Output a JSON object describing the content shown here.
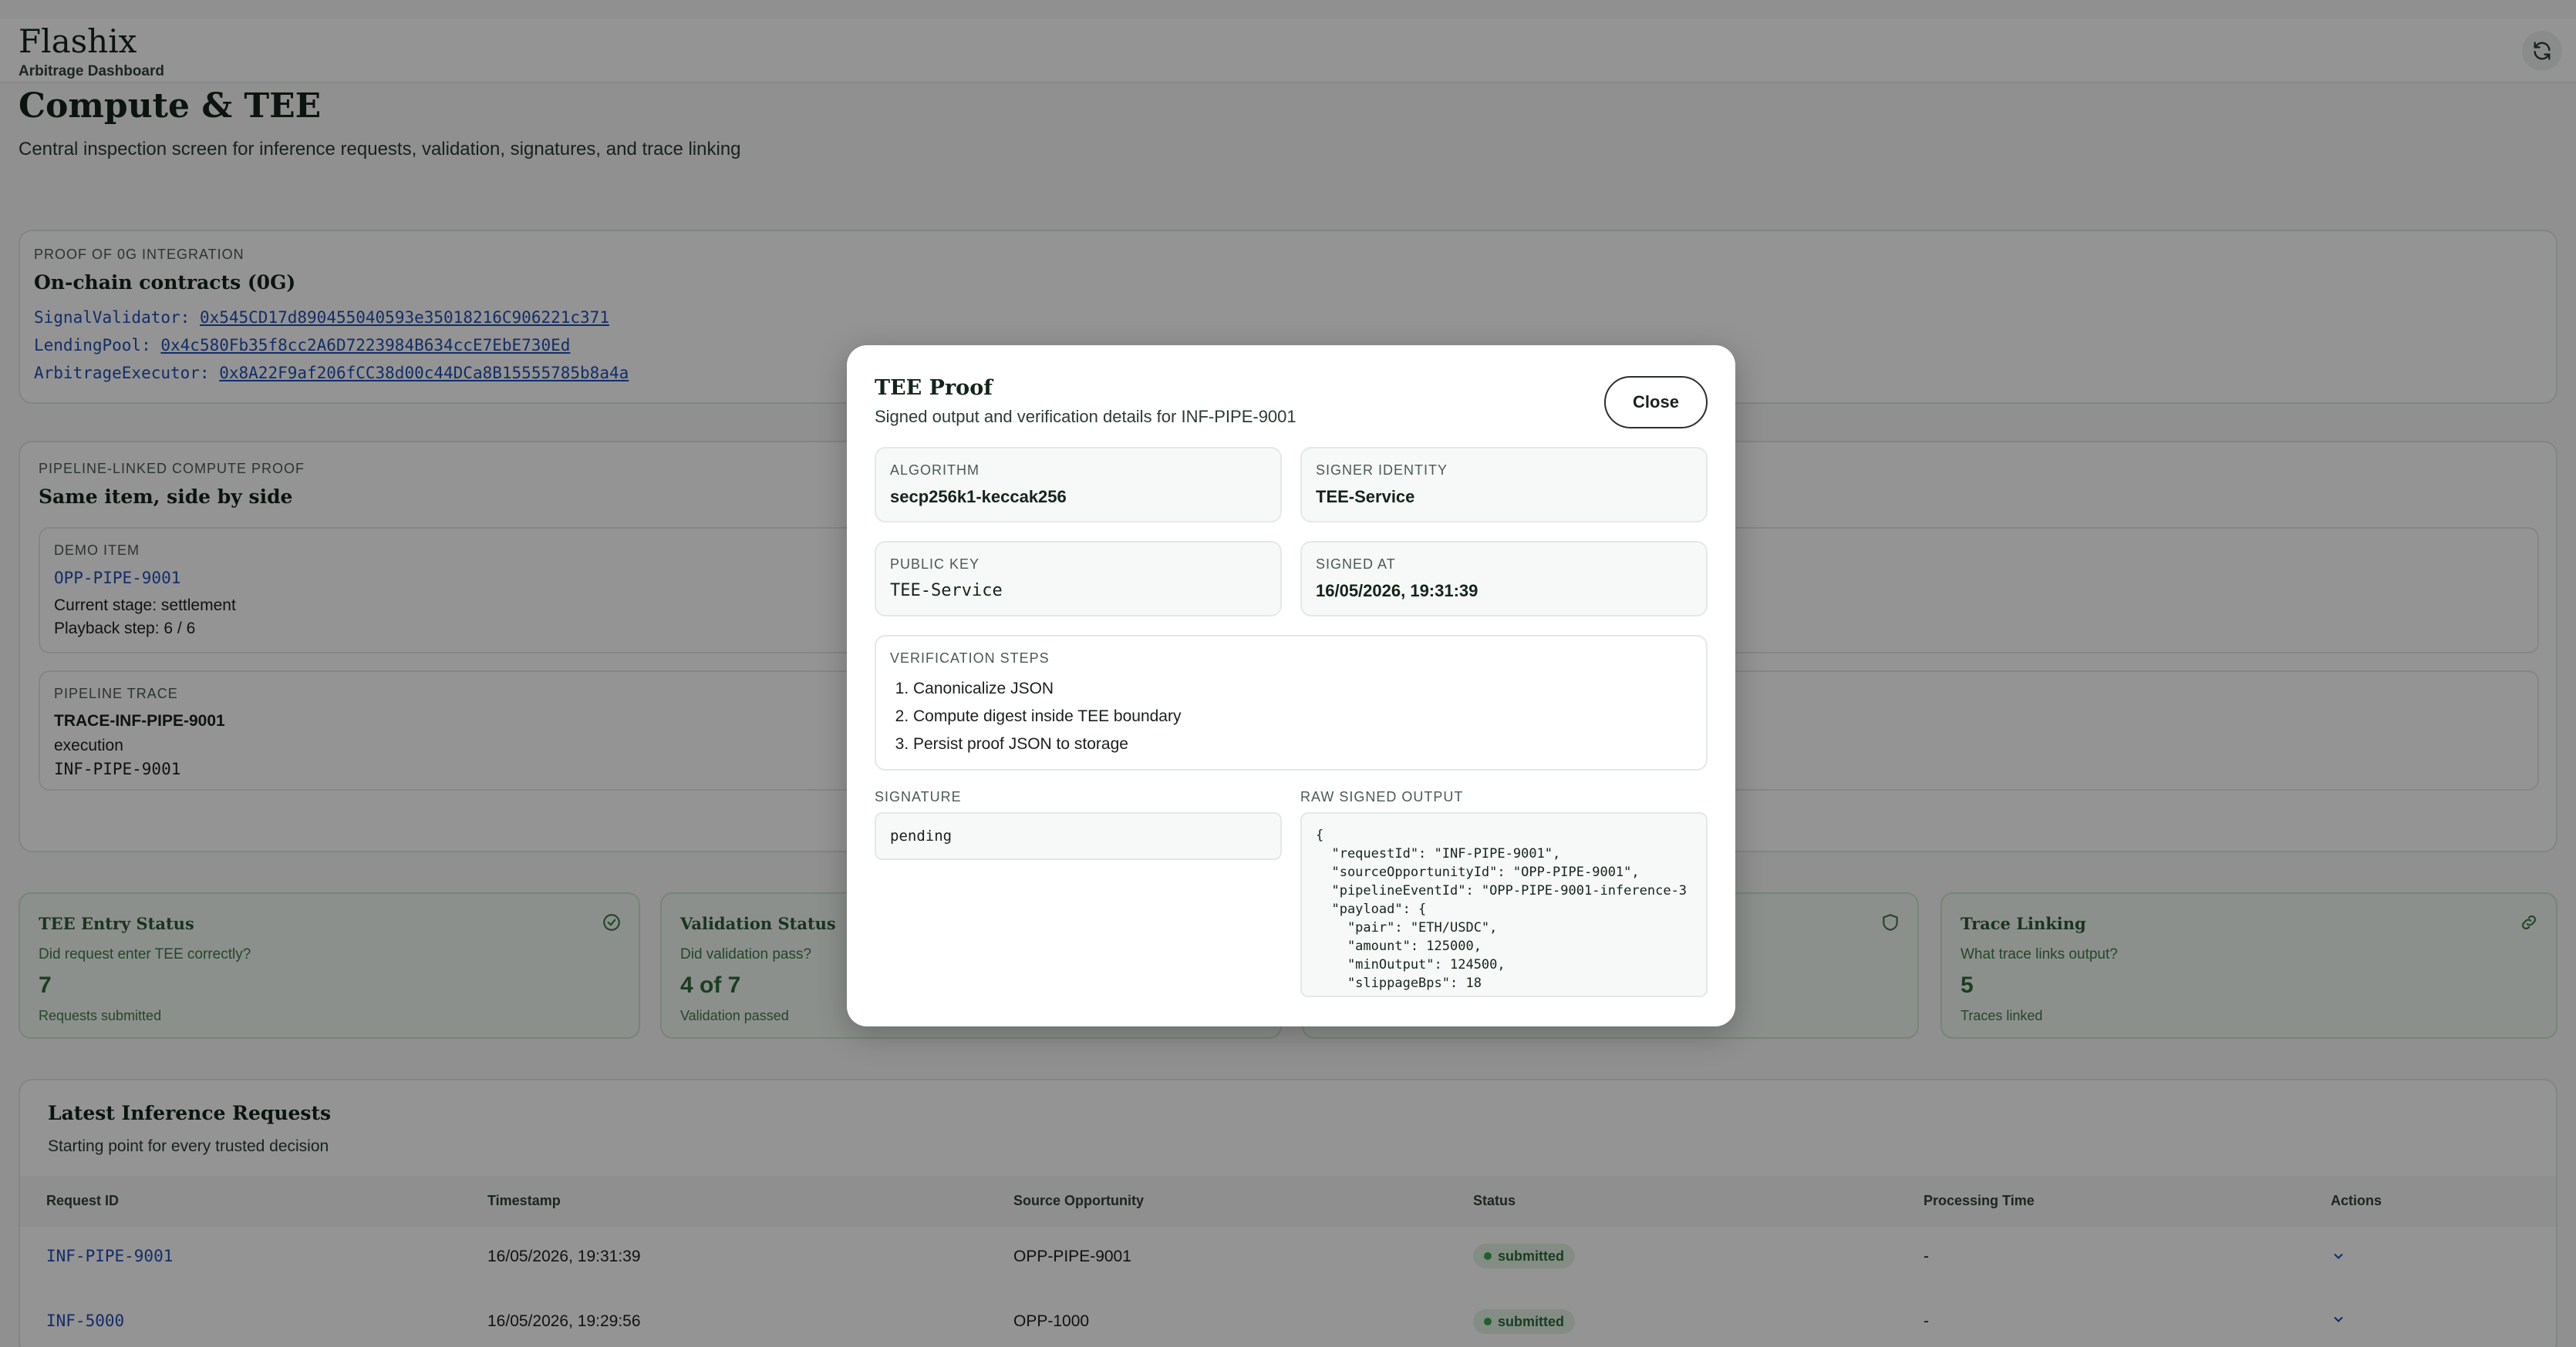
{
  "app": {
    "brand": "Flashix",
    "brand_sub": "Arbitrage Dashboard"
  },
  "page": {
    "title": "Compute & TEE",
    "subtitle": "Central inspection screen for inference requests, validation, signatures, and trace linking"
  },
  "integration": {
    "label": "PROOF OF 0G INTEGRATION",
    "title": "On-chain contracts (0G)",
    "contracts": [
      {
        "name": "SignalValidator:",
        "address": "0x545CD17d890455040593e35018216C906221c371"
      },
      {
        "name": "LendingPool:",
        "address": "0x4c580Fb35f8cc2A6D7223984B634ccE7EbE730Ed"
      },
      {
        "name": "ArbitrageExecutor:",
        "address": "0x8A22F9af206fCC38d00c44DCa8B15555785b8a4a"
      }
    ]
  },
  "pipeline": {
    "label": "PIPELINE-LINKED COMPUTE PROOF",
    "title": "Same item, side by side",
    "demo": {
      "label": "DEMO ITEM",
      "id": "OPP-PIPE-9001",
      "stage": "Current stage: settlement",
      "step": "Playback step: 6 / 6"
    },
    "trace": {
      "label": "PIPELINE TRACE",
      "id": "TRACE-INF-PIPE-9001",
      "kind": "execution",
      "inf": "INF-PIPE-9001"
    }
  },
  "stats": [
    {
      "title": "TEE Entry Status",
      "question": "Did request enter TEE correctly?",
      "value": "7",
      "caption": "Requests submitted",
      "icon": "check-circle-icon"
    },
    {
      "title": "Validation Status",
      "question": "Did validation pass?",
      "value": "4 of 7",
      "caption": "Validation passed",
      "icon": ""
    },
    {
      "title": "",
      "question": "",
      "value": "",
      "caption": "",
      "icon": ""
    },
    {
      "title": "",
      "question": "",
      "value": "",
      "caption": "",
      "icon": "shield-icon"
    },
    {
      "title": "Trace Linking",
      "question": "What trace links output?",
      "value": "5",
      "caption": "Traces linked",
      "icon": "link-icon"
    }
  ],
  "requests": {
    "title": "Latest Inference Requests",
    "subtitle": "Starting point for every trusted decision",
    "headers": [
      "Request ID",
      "Timestamp",
      "Source Opportunity",
      "Status",
      "Processing Time",
      "Actions"
    ],
    "rows": [
      {
        "id": "INF-PIPE-9001",
        "timestamp": "16/05/2026, 19:31:39",
        "source": "OPP-PIPE-9001",
        "status": "submitted",
        "time": "-"
      },
      {
        "id": "INF-5000",
        "timestamp": "16/05/2026, 19:29:56",
        "source": "OPP-1000",
        "status": "submitted",
        "time": "-"
      }
    ]
  },
  "modal": {
    "title": "TEE Proof",
    "subtitle": "Signed output and verification details for INF-PIPE-9001",
    "close_label": "Close",
    "algorithm_label": "ALGORITHM",
    "algorithm": "secp256k1-keccak256",
    "signer_label": "SIGNER IDENTITY",
    "signer": "TEE-Service",
    "pubkey_label": "PUBLIC KEY",
    "pubkey": "TEE-Service",
    "signed_at_label": "SIGNED AT",
    "signed_at": "16/05/2026, 19:31:39",
    "steps_label": "VERIFICATION STEPS",
    "steps": [
      "Canonicalize JSON",
      "Compute digest inside TEE boundary",
      "Persist proof JSON to storage"
    ],
    "signature_label": "SIGNATURE",
    "signature": "pending",
    "raw_label": "RAW SIGNED OUTPUT",
    "raw": "{\n  \"requestId\": \"INF-PIPE-9001\",\n  \"sourceOpportunityId\": \"OPP-PIPE-9001\",\n  \"pipelineEventId\": \"OPP-PIPE-9001-inference-3\n  \"payload\": {\n    \"pair\": \"ETH/USDC\",\n    \"amount\": 125000,\n    \"minOutput\": 124500,\n    \"slippageBps\": 18\n  },"
  },
  "colors": {
    "accent": "#2f6b3a",
    "link": "#1f4fb4",
    "overlay": "rgba(0,0,0,0.42)"
  }
}
